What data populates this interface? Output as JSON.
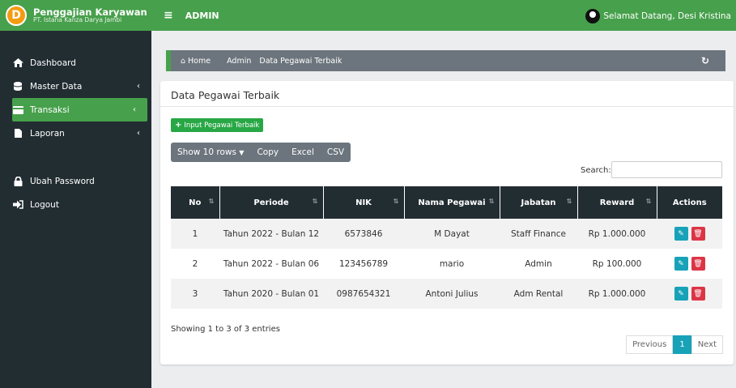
{
  "app": {
    "title": "Penggajian Karyawan",
    "subtitle": "PT. Istana Kanza Darya Jambi",
    "logo_letter": "D"
  },
  "topbar": {
    "menu_icon": "≡",
    "label": "ADMIN",
    "welcome": "Selamat Datang, Desi Kristina"
  },
  "sidebar": {
    "items": [
      {
        "label": "Dashboard",
        "icon": "home-icon"
      },
      {
        "label": "Master Data",
        "icon": "database-icon"
      },
      {
        "label": "Transaksi",
        "icon": "card-icon"
      },
      {
        "label": "Laporan",
        "icon": "file-icon"
      },
      {
        "label": "Ubah Password",
        "icon": "lock-icon"
      },
      {
        "label": "Logout",
        "icon": "logout-icon"
      }
    ]
  },
  "breadcrumb": {
    "home": "Home",
    "admin": "Admin",
    "page": "Data Pegawai Terbaik"
  },
  "card": {
    "title": "Data Pegawai Terbaik",
    "input_button": "Input Pegawai Terbaik"
  },
  "toolbar": {
    "show": "Show 10 rows",
    "copy": "Copy",
    "excel": "Excel",
    "csv": "CSV"
  },
  "search": {
    "label": "Search:"
  },
  "table": {
    "headers": [
      "No",
      "Periode",
      "NIK",
      "Nama Pegawai",
      "Jabatan",
      "Reward",
      "Actions"
    ],
    "rows": [
      [
        "1",
        "Tahun 2022 - Bulan 12",
        "6573846",
        "M Dayat",
        "Staff Finance",
        "Rp 1.000.000"
      ],
      [
        "2",
        "Tahun 2022 - Bulan 06",
        "123456789",
        "mario",
        "Admin",
        "Rp 100.000"
      ],
      [
        "3",
        "Tahun 2020 - Bulan 01",
        "0987654321",
        "Antoni Julius",
        "Adm Rental",
        "Rp 1.000.000"
      ]
    ]
  },
  "footer": {
    "showing": "Showing 1 to 3 of 3 entries",
    "previous": "Previous",
    "page": "1",
    "next": "Next"
  },
  "colors": {
    "green": "#47a04c",
    "sidebar": "#222d32",
    "info": "#17a2b8",
    "danger": "#dc3545"
  }
}
